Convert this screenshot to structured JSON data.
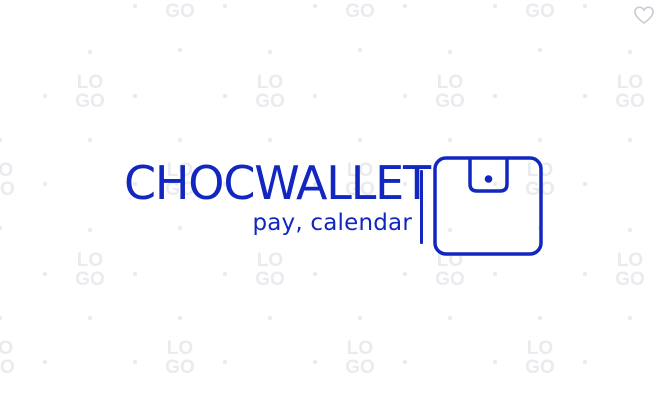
{
  "brand": {
    "name": "CHOCWALLET",
    "tagline": "pay, calendar"
  },
  "icons": {
    "logo_mark": "wallet-icon",
    "favorite": "heart-icon"
  },
  "watermark": {
    "text_top": "LO",
    "text_bottom": "GO"
  },
  "colors": {
    "brand": "#1226c0",
    "background": "#ffffff",
    "watermark": "#e9ebef"
  }
}
